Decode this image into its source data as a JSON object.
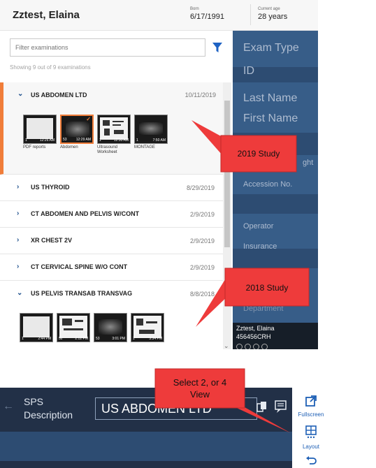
{
  "patient": {
    "name": "Zztest, Elaina",
    "born_label": "Born",
    "born": "6/17/1991",
    "age_label": "Current age",
    "age": "28 years"
  },
  "filter": {
    "placeholder": "Filter examinations",
    "showing": "Showing 9 out of 9 examinations"
  },
  "exams": [
    {
      "title": "US ABDOMEN LTD",
      "date": "10/11/2019",
      "expanded": true
    },
    {
      "title": "US THYROID",
      "date": "8/29/2019"
    },
    {
      "title": "CT ABDOMEN AND PELVIS W/CONT",
      "date": "2/9/2019"
    },
    {
      "title": "XR CHEST 2V",
      "date": "2/9/2019"
    },
    {
      "title": "CT CERVICAL SPINE W/O CONT",
      "date": "2/9/2019"
    },
    {
      "title": "US PELVIS TRANSAB TRANSVAG",
      "date": "8/8/2018",
      "expanded": true
    }
  ],
  "thumbnails_2019": [
    {
      "index": "1",
      "time": "12:26 AM",
      "caption": "PDF reports"
    },
    {
      "index": "53",
      "time": "12:29 AM",
      "caption": "Abdomen",
      "selected": true
    },
    {
      "index": "1",
      "time": "12:30 AM",
      "caption": "Ultrasound Worksheet"
    },
    {
      "index": "1",
      "time": "7:50 AM",
      "caption": "MONTAGE"
    }
  ],
  "thumbnails_2018": [
    {
      "index": "1",
      "time": "2:44 PM"
    },
    {
      "index": "52",
      "time": "2:12 PM"
    },
    {
      "index": "53",
      "time": "3:01 PM"
    },
    {
      "index": "1",
      "time": "3:34 PM"
    }
  ],
  "right_panel": {
    "exam_type": "Exam Type",
    "id": "ID",
    "last_name": "Last Name",
    "first_name": "First Name",
    "height_partial": "ght",
    "accession": "Accession No.",
    "operator": "Operator",
    "insurance": "Insurance",
    "department": "Department",
    "footer_name": "Zztest, Elaina",
    "footer_id": "456456CRH"
  },
  "callouts": {
    "study_2019": "2019 Study",
    "study_2018": "2018 Study",
    "select_view_line1": "Select 2, or 4",
    "select_view_line2": "View"
  },
  "viewer": {
    "sps_line1": "SPS",
    "sps_line2": "Description",
    "description": "US ABDOMEN LTD",
    "fullscreen": "Fullscreen",
    "layout": "Layout"
  },
  "colors": {
    "accent_orange": "#f07d3a",
    "callout_red": "#ee3b3b",
    "panel_blue": "#2d4c72",
    "link_blue": "#1d5fb5"
  },
  "icons": {
    "filter": "funnel-icon",
    "expand": "chevron-right-icon",
    "collapse": "chevron-down-icon",
    "fullscreen": "external-window-icon",
    "layout": "grid-layout-icon",
    "undo": "undo-arrow-icon"
  }
}
